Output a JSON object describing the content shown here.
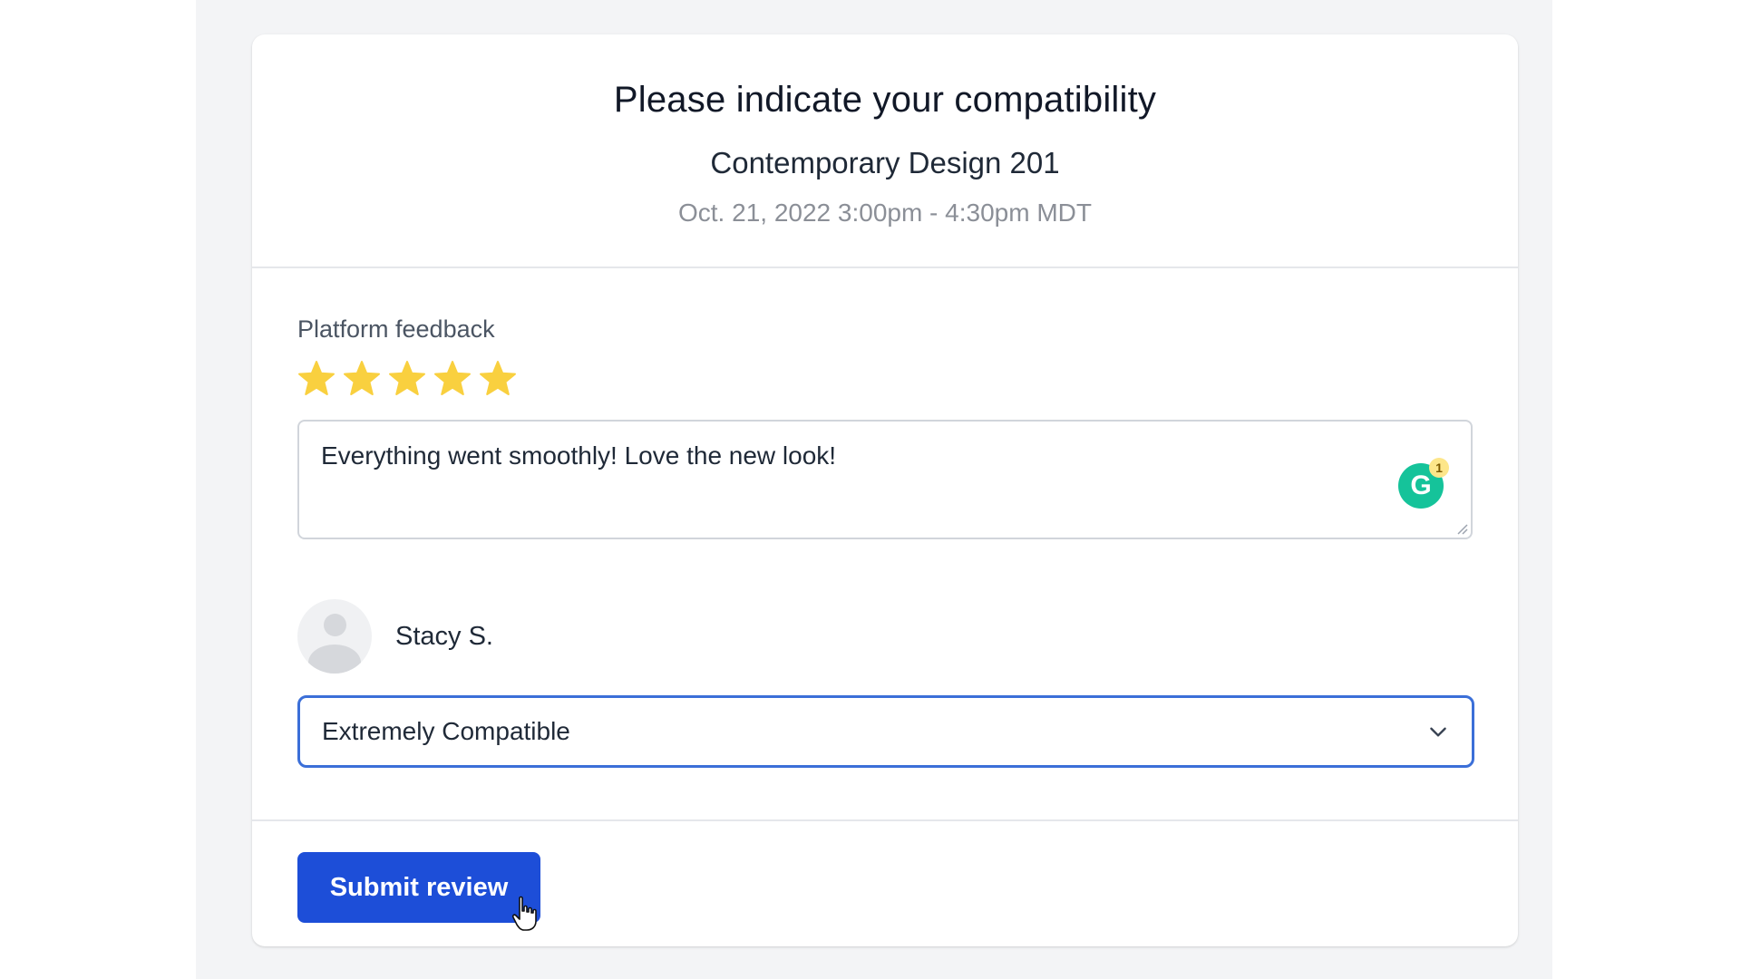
{
  "header": {
    "title": "Please indicate your compatibility",
    "course": "Contemporary Design 201",
    "datetime": "Oct. 21, 2022 3:00pm - 4:30pm MDT"
  },
  "feedback": {
    "label": "Platform feedback",
    "rating": 5,
    "rating_max": 5,
    "comment": "Everything went smoothly! Love the new look!",
    "grammarly_letter": "G",
    "grammarly_count": "1"
  },
  "participant": {
    "name": "Stacy S.",
    "compatibility_selected": "Extremely Compatible"
  },
  "footer": {
    "submit_label": "Submit review"
  },
  "colors": {
    "star": "#f9d03f",
    "primary": "#1d4ed8",
    "select_border": "#3b6fd8",
    "grammarly": "#15c39a"
  }
}
